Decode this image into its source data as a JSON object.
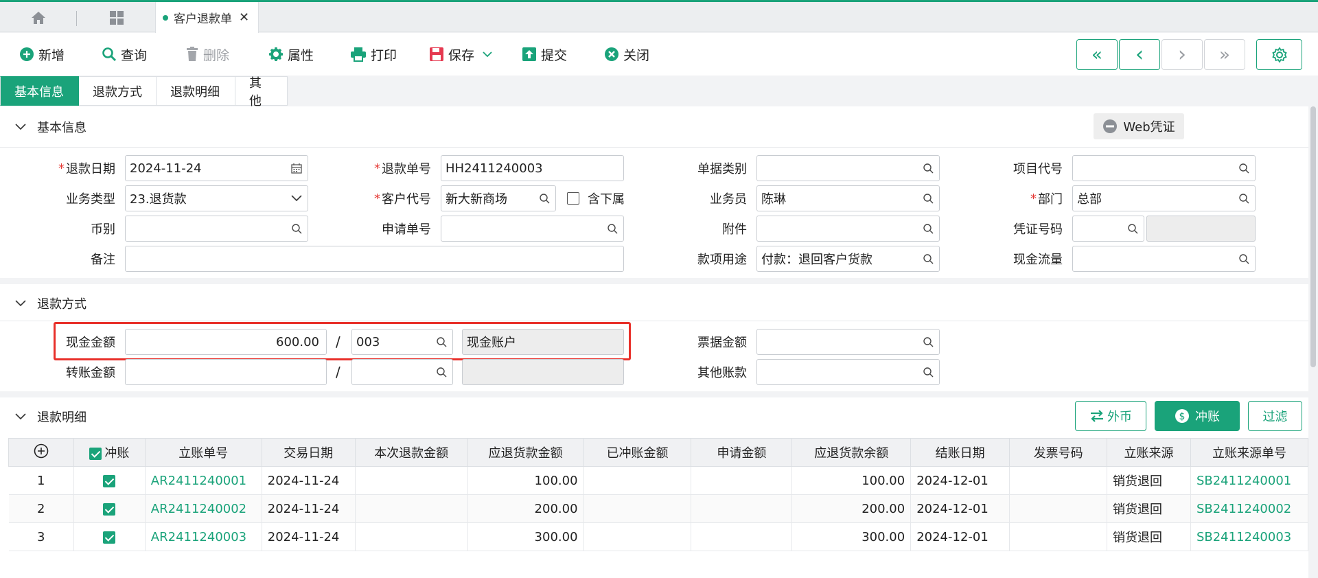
{
  "tabbar": {
    "doc_tab_label": "客户退款单",
    "close_glyph": "✕"
  },
  "toolbar": {
    "new_label": "新增",
    "query_label": "查询",
    "delete_label": "删除",
    "props_label": "属性",
    "print_label": "打印",
    "save_label": "保存",
    "submit_label": "提交",
    "close_label": "关闭",
    "first_glyph": "«",
    "prev_glyph": "‹",
    "next_glyph": "›",
    "last_glyph": "»"
  },
  "section_tabs": [
    "基本信息",
    "退款方式",
    "退款明细",
    "其他"
  ],
  "basic": {
    "title": "基本信息",
    "web_voucher_label": "Web凭证",
    "refund_date_label": "退款日期",
    "refund_date": "2024-11-24",
    "refund_no_label": "退款单号",
    "refund_no": "HH2411240003",
    "doc_type_label": "单据类别",
    "doc_type": "",
    "project_code_label": "项目代号",
    "project_code": "",
    "biz_type_label": "业务类型",
    "biz_type": "23.退货款",
    "customer_code_label": "客户代号",
    "customer_code": "新大新商场",
    "include_sub_label": "含下属",
    "salesman_label": "业务员",
    "salesman": "陈琳",
    "dept_label": "部门",
    "dept": "总部",
    "currency_label": "币别",
    "currency": "",
    "apply_no_label": "申请单号",
    "apply_no": "",
    "attachment_label": "附件",
    "attachment": "",
    "voucher_no_label": "凭证号码",
    "voucher_no": "",
    "remark_label": "备注",
    "remark": "",
    "purpose_label": "款项用途",
    "purpose": "付款：退回客户货款",
    "cashflow_label": "现金流量",
    "cashflow": ""
  },
  "method": {
    "title": "退款方式",
    "cash_amount_label": "现金金额",
    "cash_amount": "600.00",
    "slash": "/",
    "cash_account_code": "003",
    "cash_account_name": "现金账户",
    "bill_amount_label": "票据金额",
    "bill_amount": "",
    "transfer_amount_label": "转账金额",
    "transfer_amount": "",
    "transfer_account_code": "",
    "transfer_account_name": "",
    "other_account_label": "其他账款",
    "other_account": ""
  },
  "detail": {
    "title": "退款明细",
    "foreign_btn": "外币",
    "writeoff_btn": "冲账",
    "filter_btn": "过滤",
    "columns": [
      "冲账",
      "立账单号",
      "交易日期",
      "本次退款金额",
      "应退货款金额",
      "已冲账金额",
      "申请金额",
      "应退货款余额",
      "结账日期",
      "发票号码",
      "立账来源",
      "立账来源单号"
    ],
    "rows": [
      {
        "idx": "1",
        "checked": true,
        "ar_no": "AR2411240001",
        "trade_date": "2024-11-24",
        "this_refund": "",
        "due_amount": "100.00",
        "offset_amount": "",
        "apply_amount": "",
        "balance": "100.00",
        "settle_date": "2024-12-01",
        "invoice_no": "",
        "source": "销货退回",
        "source_no": "SB2411240001"
      },
      {
        "idx": "2",
        "checked": true,
        "ar_no": "AR2411240002",
        "trade_date": "2024-11-24",
        "this_refund": "",
        "due_amount": "200.00",
        "offset_amount": "",
        "apply_amount": "",
        "balance": "200.00",
        "settle_date": "2024-12-01",
        "invoice_no": "",
        "source": "销货退回",
        "source_no": "SB2411240002"
      },
      {
        "idx": "3",
        "checked": true,
        "ar_no": "AR2411240003",
        "trade_date": "2024-11-24",
        "this_refund": "",
        "due_amount": "300.00",
        "offset_amount": "",
        "apply_amount": "",
        "balance": "300.00",
        "settle_date": "2024-12-01",
        "invoice_no": "",
        "source": "销货退回",
        "source_no": "SB2411240003"
      }
    ]
  },
  "colors": {
    "accent": "#1aa37a",
    "danger": "#e8302a",
    "save": "#e53950"
  }
}
